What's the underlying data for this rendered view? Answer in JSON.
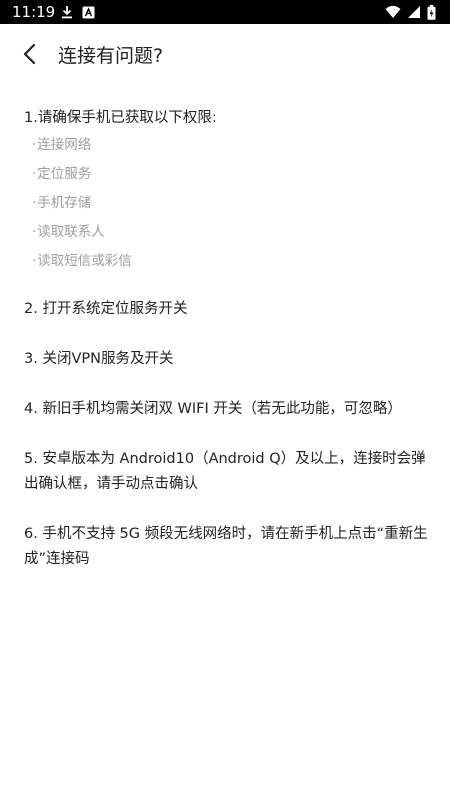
{
  "status_bar": {
    "time": "11:19",
    "left_icons": [
      "download-icon",
      "notification-a-icon"
    ],
    "right_icons": [
      "wifi-icon",
      "signal-icon",
      "battery-charging-icon"
    ]
  },
  "header": {
    "back_icon": "chevron-left-icon",
    "title": "连接有问题?"
  },
  "content": {
    "item1_heading": "1.请确保手机已获取以下权限:",
    "permissions": [
      "连接网络",
      "定位服务",
      "手机存储",
      "读取联系人",
      "读取短信或彩信"
    ],
    "permission_bullet": "·",
    "item2": "2. 打开系统定位服务开关",
    "item3": "3. 关闭VPN服务及开关",
    "item4": "4. 新旧手机均需关闭双 WIFI 开关（若无此功能，可忽略）",
    "item5": "5. 安卓版本为 Android10（Android Q）及以上，连接时会弹出确认框，请手动点击确认",
    "item6": "6. 手机不支持 5G 频段无线网络时，请在新手机上点击“重新生成”连接码"
  },
  "colors": {
    "status_bar_bg": "#000000",
    "text_primary": "#222222",
    "text_secondary": "#9e9e9e",
    "background": "#ffffff"
  }
}
